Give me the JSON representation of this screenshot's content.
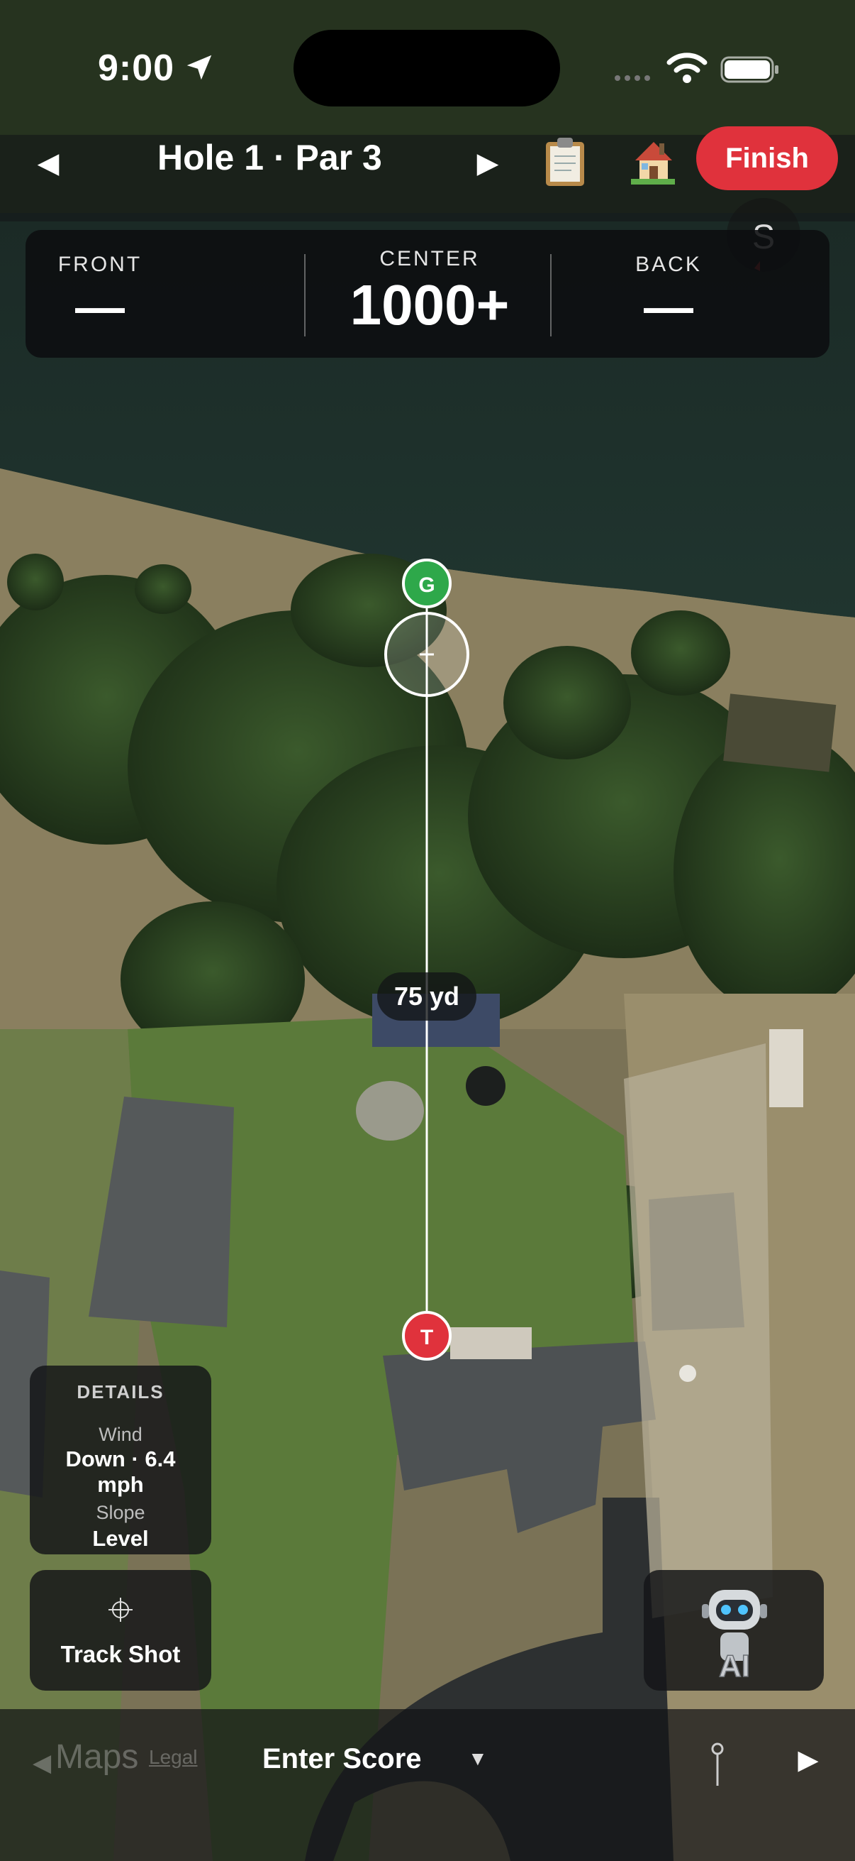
{
  "status_bar": {
    "time": "9:00"
  },
  "header": {
    "hole_title": "Hole 1 · Par 3",
    "prev_icon": "◀",
    "next_icon": "▶",
    "finish_label": "Finish",
    "compass_letter": "S"
  },
  "yardage": {
    "front_label": "FRONT",
    "front_value": "—",
    "center_label": "CENTER",
    "center_value": "1000+",
    "back_label": "BACK",
    "back_value": "—"
  },
  "map": {
    "green_marker": "G",
    "tee_marker": "T",
    "distance": "75 yd"
  },
  "details": {
    "title": "DETAILS",
    "wind_label": "Wind",
    "wind_value": "Down · 6.4 mph",
    "slope_label": "Slope",
    "slope_value": "Level"
  },
  "track_shot": {
    "label": "Track Shot"
  },
  "bottom_bar": {
    "maps_label": "Maps",
    "legal_label": "Legal",
    "enter_score": "Enter Score",
    "score_chevron": "▼",
    "prev_icon": "◀",
    "next_icon": "▶"
  },
  "colors": {
    "finish": "#e0323c",
    "green_marker": "#2ea84a",
    "tee_marker": "#e0323c"
  }
}
